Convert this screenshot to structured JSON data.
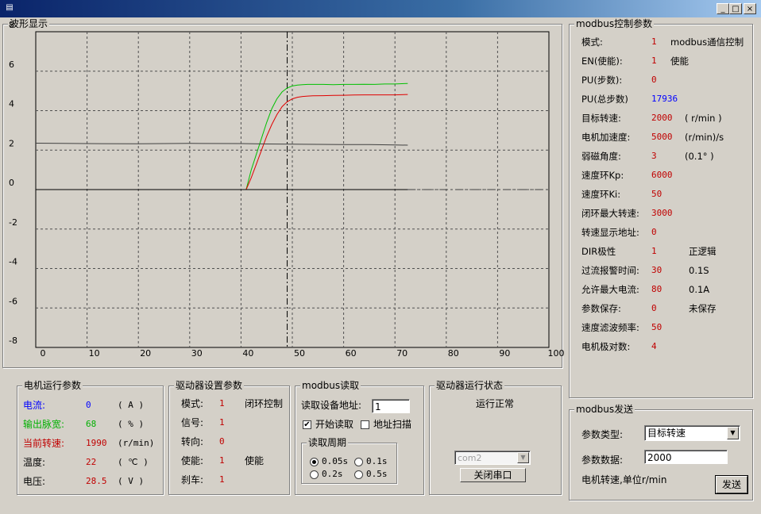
{
  "window": {
    "title": "",
    "minimize": "_",
    "maximize": "□",
    "close": "×"
  },
  "waveform": {
    "title": "波形显示",
    "chart_data": {
      "type": "line",
      "xlim": [
        0,
        100
      ],
      "ylim": [
        -8,
        8
      ],
      "x_ticks": [
        "0",
        "10",
        "20",
        "30",
        "40",
        "50",
        "60",
        "70",
        "80",
        "90",
        "100"
      ],
      "y_ticks": [
        "8",
        "6",
        "4",
        "2",
        "0",
        "-2",
        "-4",
        "-6",
        "-8"
      ],
      "grid": true,
      "cursor_x": 49,
      "series": [
        {
          "color": "#00c000",
          "x": [
            0,
            40,
            41,
            42,
            43,
            44,
            45,
            46,
            47,
            48,
            49,
            50,
            51,
            52,
            53,
            54,
            56,
            58,
            60,
            62,
            64,
            66,
            68,
            70,
            72.5
          ],
          "y": [
            0,
            0,
            0,
            1.0,
            1.8,
            2.6,
            3.4,
            4.1,
            4.6,
            4.95,
            5.15,
            5.25,
            5.3,
            5.32,
            5.33,
            5.33,
            5.33,
            5.32,
            5.33,
            5.33,
            5.34,
            5.33,
            5.35,
            5.35,
            5.38
          ]
        },
        {
          "color": "#e00000",
          "x": [
            0,
            41,
            42,
            43,
            44,
            45,
            46,
            47,
            48,
            49,
            50,
            51,
            52,
            53,
            54,
            56,
            58,
            60,
            62,
            64,
            66,
            68,
            70,
            72.5
          ],
          "y": [
            0,
            0,
            0.6,
            1.3,
            2.0,
            2.7,
            3.3,
            3.8,
            4.2,
            4.45,
            4.6,
            4.68,
            4.72,
            4.74,
            4.75,
            4.76,
            4.77,
            4.78,
            4.79,
            4.8,
            4.8,
            4.8,
            4.8,
            4.82
          ]
        },
        {
          "color": "#404040",
          "x": [
            0,
            10,
            20,
            30,
            40,
            45,
            50,
            55,
            60,
            65,
            70,
            72.5
          ],
          "y": [
            2.35,
            2.33,
            2.32,
            2.34,
            2.33,
            2.31,
            2.3,
            2.29,
            2.28,
            2.28,
            2.26,
            2.25
          ]
        },
        {
          "color": "#0000ff",
          "x": [
            40,
            72.5
          ],
          "y": [
            0,
            0
          ]
        },
        {
          "color": "#000000",
          "x": [
            0,
            72.5
          ],
          "y": [
            0,
            0
          ]
        },
        {
          "color": "#404040",
          "dashed": true,
          "x": [
            72.5,
            100
          ],
          "y": [
            0,
            0
          ]
        }
      ]
    }
  },
  "motor": {
    "title": "电机运行参数",
    "rows": [
      {
        "label": "电流:",
        "value": "0",
        "unit": "( A )",
        "color": "#0000ff",
        "label_color": "#0000ff"
      },
      {
        "label": "输出脉宽:",
        "value": "68",
        "unit": "( % )",
        "color": "#00b000",
        "label_color": "#00b000"
      },
      {
        "label": "当前转速:",
        "value": "1990",
        "unit": "(r/min)",
        "color": "#c00000",
        "label_color": "#c00000"
      },
      {
        "label": "温度:",
        "value": "22",
        "unit": "( ℃ )",
        "color": "#c00000",
        "label_color": "#000000"
      },
      {
        "label": "电压:",
        "value": "28.5",
        "unit": "( V )",
        "color": "#c00000",
        "label_color": "#000000"
      }
    ]
  },
  "driver_settings": {
    "title": "驱动器设置参数",
    "rows": [
      {
        "label": "模式:",
        "value": "1",
        "note": "闭环控制"
      },
      {
        "label": "信号:",
        "value": "1",
        "note": ""
      },
      {
        "label": "转向:",
        "value": "0",
        "note": ""
      },
      {
        "label": "使能:",
        "value": "1",
        "note": "使能"
      },
      {
        "label": "刹车:",
        "value": "1",
        "note": ""
      }
    ]
  },
  "modbus_read": {
    "title": "modbus读取",
    "address_label": "读取设备地址:",
    "address_value": "1",
    "start_read_label": "开始读取",
    "start_read_checked": true,
    "scan_label": "地址扫描",
    "scan_checked": false,
    "period_title": "读取周期",
    "periods": [
      {
        "label": "0.05s",
        "selected": true
      },
      {
        "label": "0.1s",
        "selected": false
      },
      {
        "label": "0.2s",
        "selected": false
      },
      {
        "label": "0.5s",
        "selected": false
      }
    ]
  },
  "driver_status": {
    "title": "驱动器运行状态",
    "status": "运行正常",
    "port": "com2",
    "close_port_label": "关闭串口"
  },
  "modbus_params": {
    "title": "modbus控制参数",
    "rows": [
      {
        "label": "模式:",
        "value": "1",
        "note": "modbus通信控制",
        "color": "#c00000"
      },
      {
        "label": "EN(使能):",
        "value": "1",
        "note": "使能",
        "color": "#c00000"
      },
      {
        "label": "PU(步数):",
        "value": "0",
        "note": "",
        "color": "#c00000"
      },
      {
        "label": "PU(总步数)",
        "value": "17936",
        "note": "",
        "color": "#0000ff"
      },
      {
        "label": "目标转速:",
        "value": "2000",
        "note": "( r/min )",
        "color": "#c00000"
      },
      {
        "label": "电机加速度:",
        "value": "5000",
        "note": "(r/min)/s",
        "color": "#c00000"
      },
      {
        "label": "弱磁角度:",
        "value": "3",
        "note": "(0.1° )",
        "color": "#c00000"
      },
      {
        "label": "速度环Kp:",
        "value": "6000",
        "note": "",
        "color": "#c00000"
      },
      {
        "label": "速度环Ki:",
        "value": "50",
        "note": "",
        "color": "#c00000"
      },
      {
        "label": "闭环最大转速:",
        "value": "3000",
        "note": "",
        "color": "#c00000"
      },
      {
        "label": "转速显示地址:",
        "value": "0",
        "note": "",
        "color": "#c00000"
      },
      {
        "label": "DIR极性",
        "value": "1",
        "note": "正逻辑",
        "color": "#c00000"
      },
      {
        "label": "过流报警时间:",
        "value": "30",
        "note": "0.1S",
        "color": "#c00000"
      },
      {
        "label": "允许最大电流:",
        "value": "80",
        "note": "0.1A",
        "color": "#c00000"
      },
      {
        "label": "参数保存:",
        "value": "0",
        "note": "未保存",
        "color": "#c00000"
      },
      {
        "label": "速度滤波频率:",
        "value": "50",
        "note": "",
        "color": "#c00000"
      },
      {
        "label": "电机极对数:",
        "value": "4",
        "note": "",
        "color": "#c00000"
      }
    ]
  },
  "modbus_send": {
    "title": "modbus发送",
    "type_label": "参数类型:",
    "type_value": "目标转速",
    "data_label": "参数数据:",
    "data_value": "2000",
    "hint": "电机转速,单位r/min",
    "send_label": "发送"
  }
}
